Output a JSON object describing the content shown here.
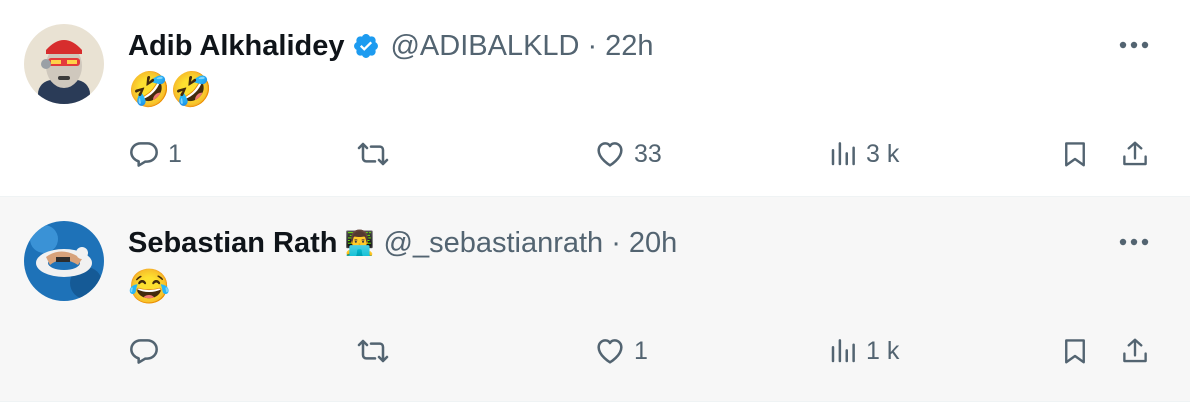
{
  "tweets": [
    {
      "name": "Adib Alkhalidey",
      "verified": true,
      "handle": "@ADIBALKLD",
      "separator": "·",
      "time": "22h",
      "text": "🤣🤣",
      "name_badge_icon": "verified-badge-icon",
      "avatar_description_icon": "cartoon-ape-avatar-icon",
      "replies": "1",
      "retweets": "",
      "likes": "33",
      "views": "3 k"
    },
    {
      "name": "Sebastian Rath",
      "verified": false,
      "handle": "@_sebastianrath",
      "separator": "·",
      "time": "20h",
      "text": "😂",
      "name_badge_icon": "technologist-emoji-icon",
      "name_badge_emoji": "👨‍💻",
      "avatar_description_icon": "pool-float-photo-avatar-icon",
      "replies": "",
      "retweets": "",
      "likes": "1",
      "views": "1 k"
    }
  ],
  "colors": {
    "text_primary": "#0f1419",
    "text_secondary": "#536471",
    "verified_blue": "#1d9bf0",
    "row2_background": "#f7f7f7",
    "divider": "#eff3f4"
  }
}
